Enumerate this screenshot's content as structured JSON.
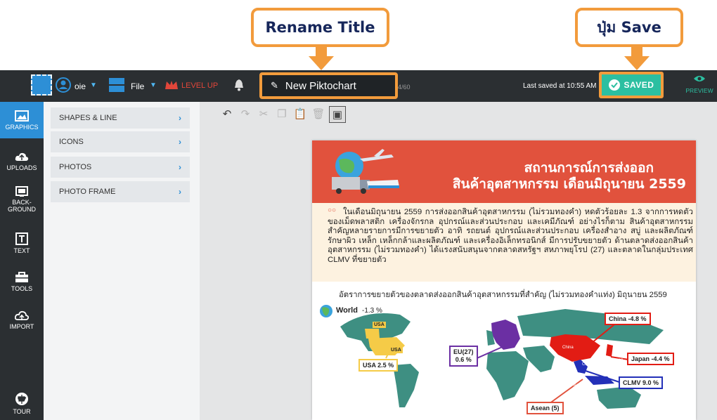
{
  "callouts": {
    "rename": "Rename Title",
    "save": "ปุ่ม Save"
  },
  "topbar": {
    "user": "oie",
    "file": "File",
    "level_up": "LEVEL UP",
    "title": "New Piktochart",
    "char_count": "4/60",
    "last_saved": "Last saved at 10:55 AM",
    "saved": "SAVED",
    "preview": "PREVIEW"
  },
  "leftnav": {
    "graphics": "GRAPHICS",
    "uploads": "UPLOADS",
    "background": "BACK-\nGROUND",
    "text": "TEXT",
    "tools": "TOOLS",
    "import": "IMPORT",
    "tour": "TOUR"
  },
  "panel": {
    "items": [
      "SHAPES & LINE",
      "ICONS",
      "PHOTOS",
      "PHOTO FRAME"
    ]
  },
  "poster": {
    "title_line1": "สถานการณ์การส่งออก",
    "title_line2": "สินค้าอุตสาหกรรม เดือนมิถุนายน 2559",
    "paragraph": "ในเดือนมิถุนายน 2559 การส่งออกสินค้าอุตสาหกรรม (ไม่รวมทองคำ) หดตัวร้อยละ 1.3 จากการหดตัวของเม็ดพลาสติก เครื่องจักรกล อุปกรณ์และส่วนประกอบ และเคมีภัณฑ์ อย่างไรก็ตาม สินค้าอุตสาหกรรมสำคัญหลายรายการมีการขยายตัว อาทิ รถยนต์ อุปกรณ์และส่วนประกอบ เครื่องสำอาง สบู่ และผลิตภัณฑ์รักษาผิว เหล็ก เหล็กกล้าและผลิตภัณฑ์ และเครื่องอิเล็กทรอนิกส์ มีการปรับขยายตัว ด้านตลาดส่งออกสินค้าอุตสาหกรรม (ไม่รวมทองคำ) ได้แรงสนับสนุนจากตลาดสหรัฐฯ สหภาพยุโรป (27) และตลาดในกลุ่มประเทศ CLMV ที่ขยายตัว",
    "map_title": "อัตราการขยายตัวของตลาดส่งออกสินค้าอุตสาหกรรมที่สำคัญ (ไม่รวมทองคำแท่ง) มิถุนายน 2559",
    "world_label": "World",
    "world_value": "-1.3 %",
    "labels": {
      "usa_box": "USA  2.5 %",
      "usa_map1": "USA",
      "usa_map2": "USA",
      "eu_box_1": "EU(27)",
      "eu_box_2": "0.6 %",
      "eu_map": "EU(27)",
      "china": "China -4.8 %",
      "china_map": "China",
      "japan": "Japan  -4.4 %",
      "japan_map": "Japan",
      "clmv": "CLMV  9.0 %",
      "clmv_map": "CLMV",
      "asean": "Asean (5)",
      "asean_map": "Asean(5)"
    }
  },
  "colors": {
    "accent_orange": "#f29b3c",
    "topbar": "#2b2f32",
    "brand_blue": "#2d8fd6",
    "saved_green": "#2cbfa1",
    "poster_header": "#e1523d"
  }
}
